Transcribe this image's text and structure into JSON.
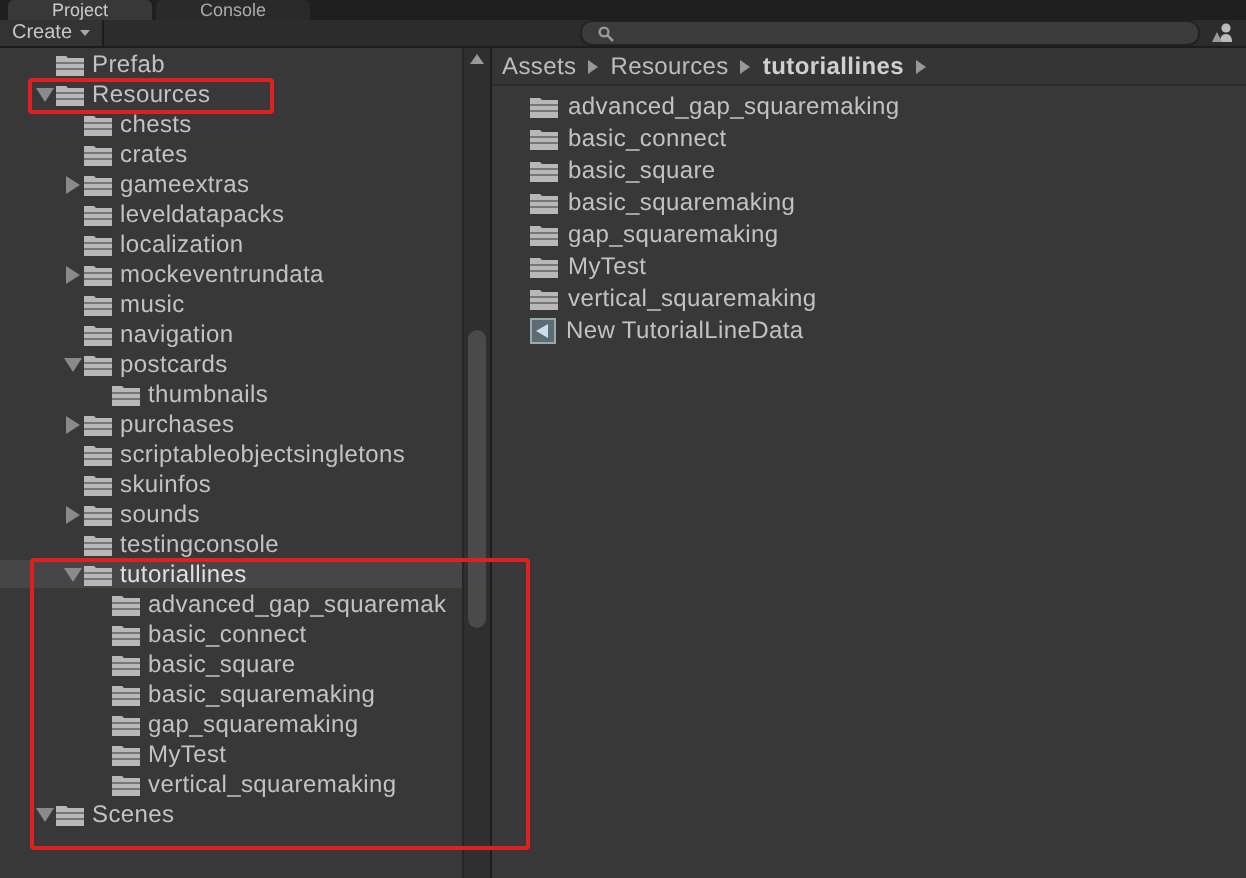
{
  "tabs": [
    {
      "label": "Project",
      "selected": true
    },
    {
      "label": "Console",
      "selected": false
    }
  ],
  "toolbar": {
    "create_button": "Create"
  },
  "tree": [
    {
      "name": "Prefab",
      "selected": false
    },
    {
      "name": "Resources",
      "expanded": true,
      "selected": false,
      "children": [
        {
          "name": "chests",
          "selected": false
        },
        {
          "name": "crates",
          "selected": false
        },
        {
          "name": "gameextras",
          "expanded": false,
          "selected": false
        },
        {
          "name": "leveldatapacks",
          "selected": false
        },
        {
          "name": "localization",
          "selected": false
        },
        {
          "name": "mockeventrundata",
          "expanded": false,
          "selected": false
        },
        {
          "name": "music",
          "selected": false
        },
        {
          "name": "navigation",
          "selected": false
        },
        {
          "name": "postcards",
          "expanded": true,
          "selected": false,
          "children": [
            {
              "name": "thumbnails",
              "selected": false
            }
          ]
        },
        {
          "name": "purchases",
          "expanded": false,
          "selected": false
        },
        {
          "name": "scriptableobjectsingletons",
          "selected": false
        },
        {
          "name": "skuinfos",
          "selected": false
        },
        {
          "name": "sounds",
          "expanded": false,
          "selected": false
        },
        {
          "name": "testingconsole",
          "selected": false
        },
        {
          "name": "tutoriallines",
          "expanded": true,
          "selected": true,
          "children": [
            {
              "name": "advanced_gap_squaremak",
              "selected": false
            },
            {
              "name": "basic_connect",
              "selected": false
            },
            {
              "name": "basic_square",
              "selected": false
            },
            {
              "name": "basic_squaremaking",
              "selected": false
            },
            {
              "name": "gap_squaremaking",
              "selected": false
            },
            {
              "name": "MyTest",
              "selected": false
            },
            {
              "name": "vertical_squaremaking",
              "selected": false
            }
          ]
        }
      ]
    },
    {
      "name": "Scenes",
      "expanded": true,
      "selected": false
    }
  ],
  "breadcrumb": [
    "Assets",
    "Resources",
    "tutoriallines"
  ],
  "items": [
    {
      "name": "advanced_gap_squaremaking",
      "kind": "folder"
    },
    {
      "name": "basic_connect",
      "kind": "folder"
    },
    {
      "name": "basic_square",
      "kind": "folder"
    },
    {
      "name": "basic_squaremaking",
      "kind": "folder"
    },
    {
      "name": "gap_squaremaking",
      "kind": "folder"
    },
    {
      "name": "MyTest",
      "kind": "folder"
    },
    {
      "name": "vertical_squaremaking",
      "kind": "folder"
    },
    {
      "name": "New TutorialLineData",
      "kind": "asset"
    }
  ]
}
